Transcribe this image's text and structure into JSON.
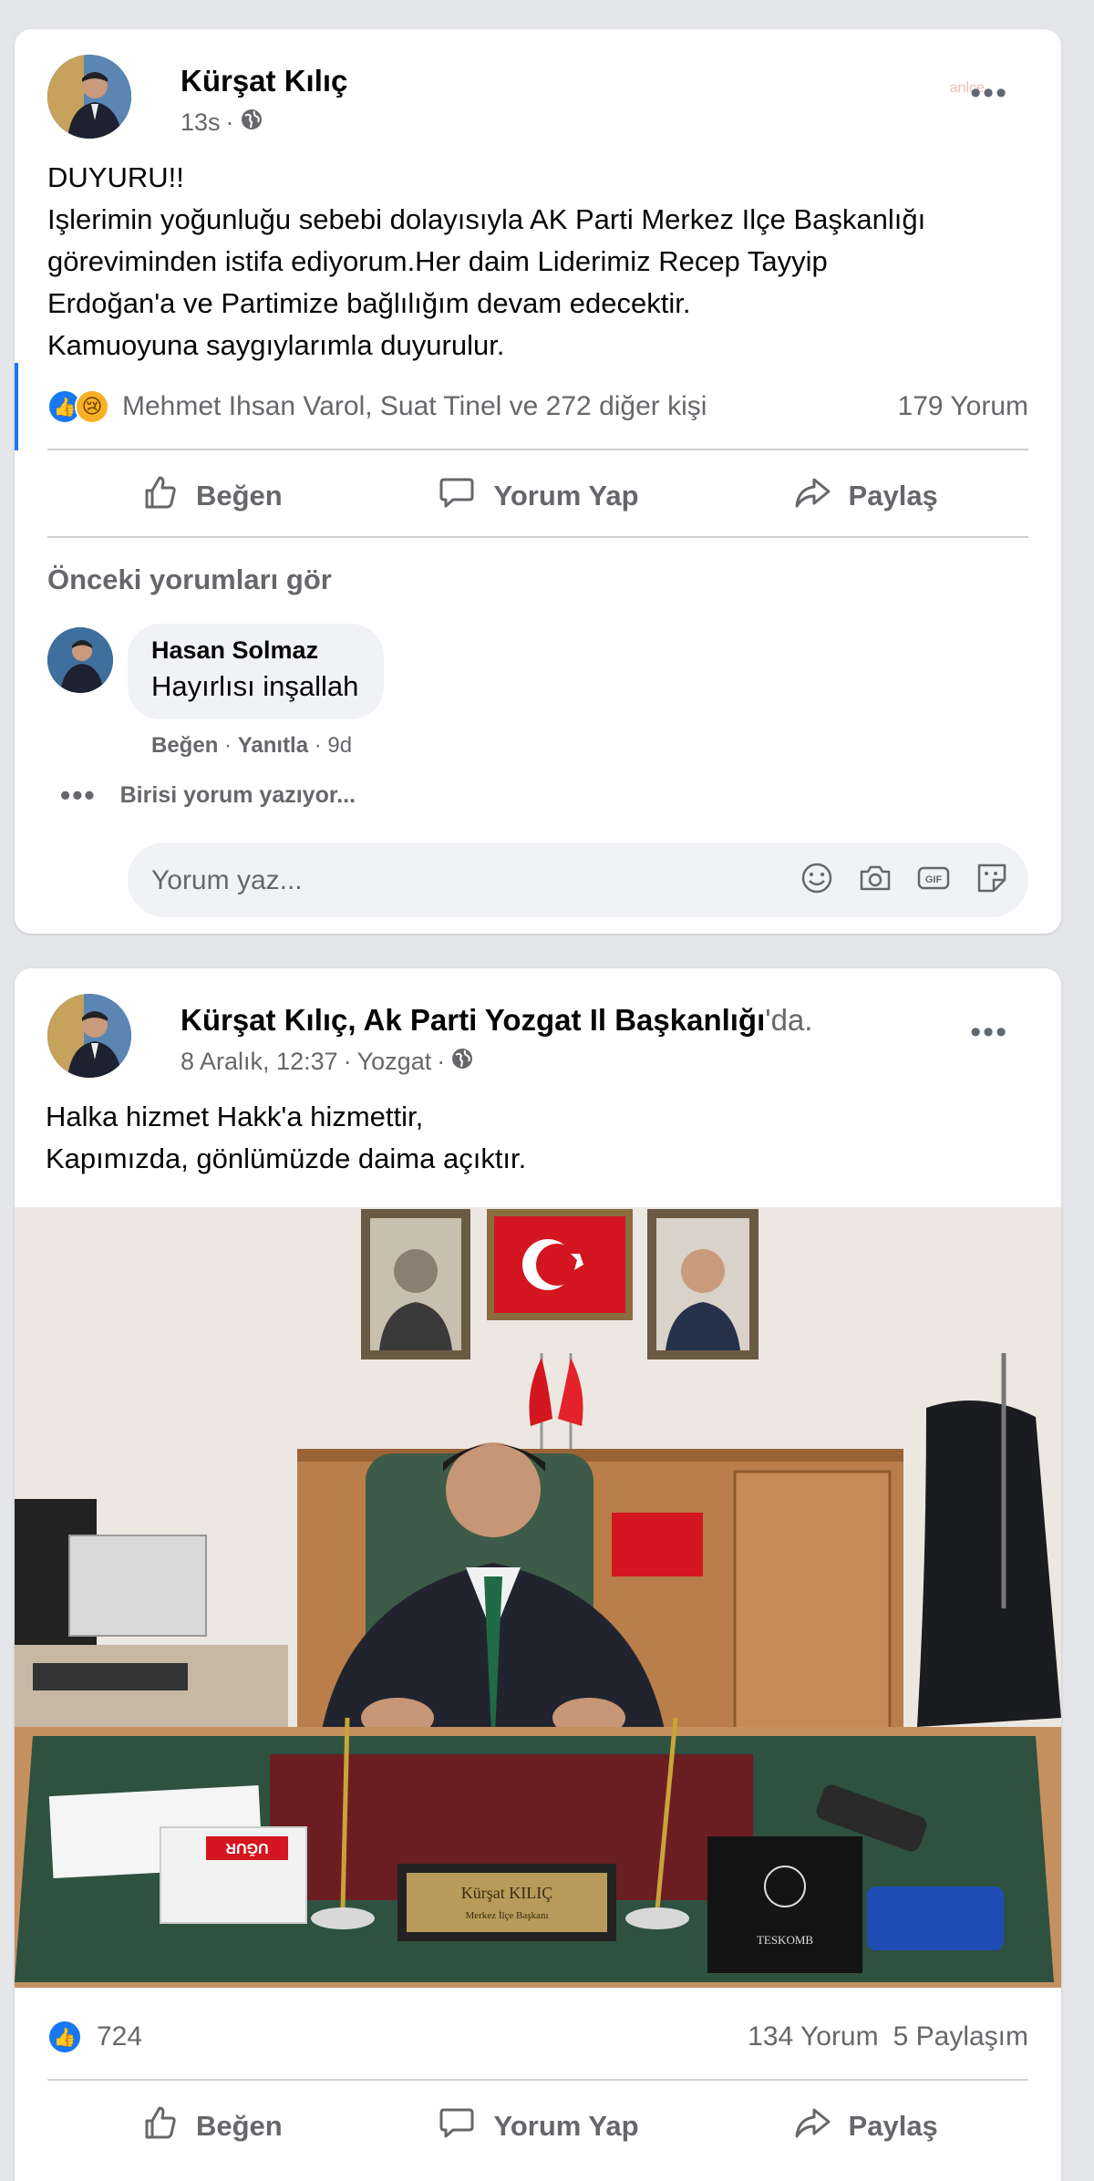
{
  "post1": {
    "author": "Kürşat Kılıç",
    "time": "13s",
    "text_lines": [
      "DUYURU!!",
      "Işlerimin yoğunluğu sebebi dolayısıyla AK Parti Merkez Ilçe Başkanlığı",
      "göreviminden istifa ediyorum.Her daim Liderimiz Recep Tayyip",
      "Erdoğan'a ve Partimize bağlılığım devam edecektir.",
      "Kamuoyuna saygıylarımla duyurulur."
    ],
    "reactions_text": "Mehmet Ihsan Varol, Suat Tinel ve 272 diğer kişi",
    "comments_count": "179 Yorum",
    "actions": {
      "like": "Beğen",
      "comment": "Yorum Yap",
      "share": "Paylaş"
    },
    "previous_comments": "Önceki yorumları gör",
    "comment": {
      "author": "Hasan Solmaz",
      "text": "Hayırlısı inşallah",
      "like": "Beğen",
      "reply": "Yanıtla",
      "time": "9d"
    },
    "typing": "Birisi yorum yazıyor...",
    "reply_placeholder": "Yorum yaz...",
    "watermark": "anlce"
  },
  "post2": {
    "author": "Kürşat Kılıç",
    "separator": ", ",
    "page": "Ak Parti Yozgat Il Başkanlığı",
    "page_suffix": "'da.",
    "time": "8 Aralık, 12:37",
    "location": "Yozgat",
    "text_lines": [
      "Halka hizmet Hakk'a hizmettir,",
      "Kapımızda, gönlümüzde daima açıktır."
    ],
    "photo": {
      "nameplate_name": "Kürşat KILIÇ",
      "nameplate_title": "Merkez İlçe Başkanı",
      "box_brand": "TESKOMB",
      "tissue_label": "UĞUR"
    },
    "likes_count": "724",
    "comments_count": "134 Yorum",
    "shares_count": "5 Paylaşım",
    "actions": {
      "like": "Beğen",
      "comment": "Yorum Yap",
      "share": "Paylaş"
    }
  },
  "colors": {
    "accent": "#1877f2",
    "muted": "#65676b",
    "background": "#e4e6ea"
  },
  "icons": [
    "globe-icon",
    "more-icon",
    "like-icon",
    "comment-icon",
    "share-icon",
    "smile-icon",
    "camera-icon",
    "gif-icon",
    "sticker-icon"
  ]
}
